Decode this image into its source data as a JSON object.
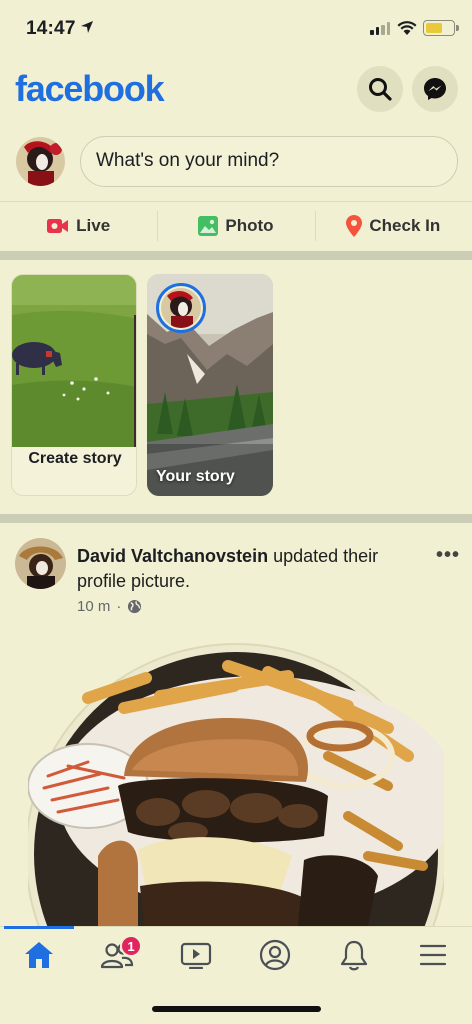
{
  "status": {
    "time": "14:47"
  },
  "header": {
    "logo": "facebook"
  },
  "composer": {
    "placeholder": "What's on your mind?"
  },
  "actions": [
    {
      "label": "Live",
      "icon": "live-video-icon",
      "color": "#e8334a"
    },
    {
      "label": "Photo",
      "icon": "photo-icon",
      "color": "#45bd62"
    },
    {
      "label": "Check In",
      "icon": "location-pin-icon",
      "color": "#f5533d"
    }
  ],
  "stories": {
    "create_label": "Create story",
    "your_label": "Your story"
  },
  "post": {
    "author": "David Valtchanovstein",
    "action": " updated their profile picture.",
    "time": "10 m",
    "privacy_icon": "globe-icon",
    "more": "•••"
  },
  "tabbar": {
    "items": [
      "home-icon",
      "friends-icon",
      "watch-icon",
      "profile-icon",
      "notifications-icon",
      "menu-icon"
    ],
    "friends_badge": "1",
    "active": "home"
  },
  "colors": {
    "brand": "#1f6fe0",
    "background": "#f1f0d2",
    "badge": "#e0245e"
  }
}
